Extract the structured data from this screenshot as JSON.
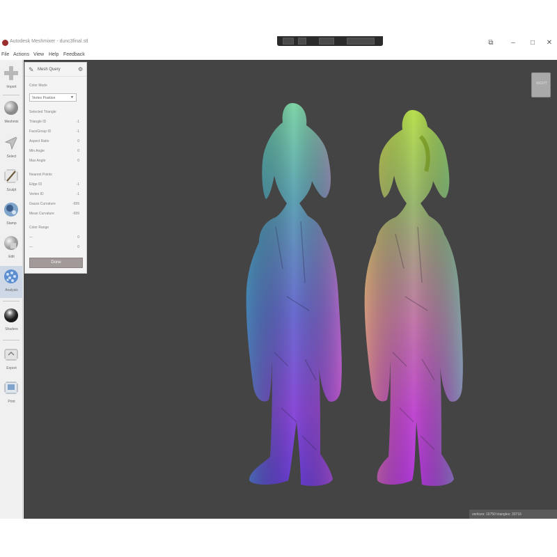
{
  "window": {
    "title": "Autodesk Meshmixer - dunc3final.stl",
    "controls": {
      "restore": "⧉",
      "minimize": "–",
      "maximize": "□",
      "close": "✕"
    }
  },
  "menu": [
    "File",
    "Actions",
    "View",
    "Help",
    "Feedback"
  ],
  "tools": [
    {
      "name": "plus-icon",
      "label": "Import"
    },
    {
      "name": "sphere-icon",
      "label": "Meshmix"
    },
    {
      "name": "arrow-cursor-icon",
      "label": "Select"
    },
    {
      "name": "brush-icon",
      "label": "Sculpt"
    },
    {
      "name": "stamp-icon",
      "label": "Stamp"
    },
    {
      "name": "edit-sphere-icon",
      "label": "Edit"
    },
    {
      "name": "analysis-icon",
      "label": "Analysis"
    },
    {
      "name": "shaders-icon",
      "label": "Shaders"
    },
    {
      "name": "export-icon",
      "label": "Export"
    },
    {
      "name": "print-icon",
      "label": "Print"
    }
  ],
  "panel": {
    "title": "Mesh Query",
    "color_mode_label": "Color Mode",
    "color_mode_value": "Vertex Position",
    "selected_triangle_label": "Selected Triangle",
    "rows_triangle": [
      {
        "label": "Triangle ID",
        "value": "-1"
      },
      {
        "label": "FaceGroup ID",
        "value": "-1"
      },
      {
        "label": "Aspect Ratio",
        "value": "0"
      },
      {
        "label": "Min Angle",
        "value": "0"
      },
      {
        "label": "Max Angle",
        "value": "0"
      }
    ],
    "nearest_points_label": "Nearest Points",
    "rows_points": [
      {
        "label": "Edge ID",
        "value": "-1"
      },
      {
        "label": "Vertex ID",
        "value": "-1"
      },
      {
        "label": "Gauss Curvature",
        "value": "-999"
      },
      {
        "label": "Mean Curvature",
        "value": "-999"
      }
    ],
    "color_range_label": "Color Range",
    "rows_range": [
      {
        "label": "—",
        "value": "0"
      },
      {
        "label": "—",
        "value": "0"
      }
    ],
    "done_label": "Done"
  },
  "viewcube_label": "RIGHT",
  "status": "vertices: 16750 triangles: 33716",
  "colors": {
    "viewport_bg": "#444444",
    "panel_bg": "#f4f4f4",
    "active_tool": "#cfd8e6",
    "done_button": "#a29a98"
  }
}
